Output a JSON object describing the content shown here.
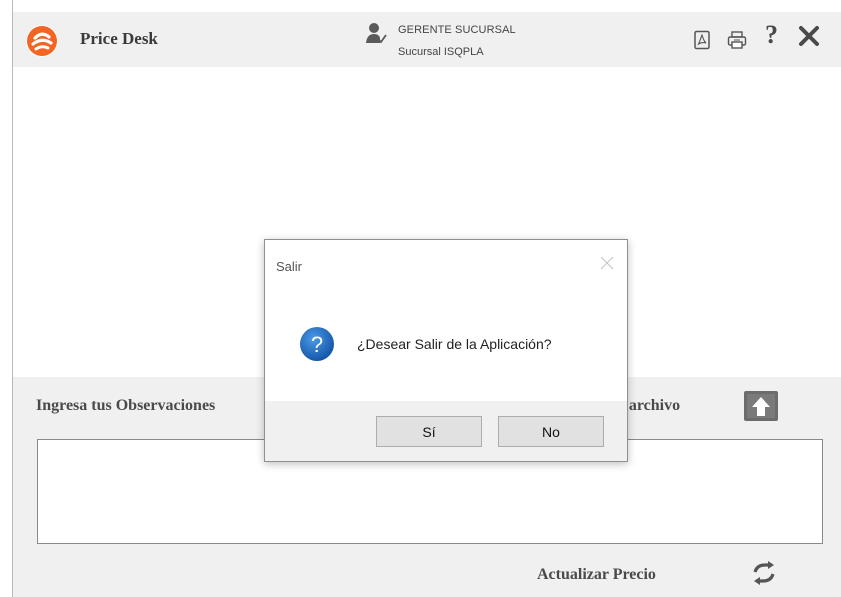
{
  "app": {
    "title": "Price Desk"
  },
  "user": {
    "role": "GERENTE SUCURSAL",
    "branch": "Sucursal ISQPLA"
  },
  "header_icons": [
    "pdf-icon",
    "print-icon",
    "help-icon",
    "close-icon"
  ],
  "help_glyph": "?",
  "observations": {
    "label": "Ingresa tus Observaciones",
    "value": ""
  },
  "file": {
    "label": "r archivo"
  },
  "refresh": {
    "label": "Actualizar Precio"
  },
  "dialog": {
    "title": "Salir",
    "message": "¿Desear Salir de la Aplicación?",
    "yes_label": "Sí",
    "no_label": "No",
    "icon": "question-icon"
  },
  "colors": {
    "logo_orange": "#f26522",
    "dialog_icon_blue": "#1f6fc5",
    "panel_bg": "#f0f0f0"
  }
}
